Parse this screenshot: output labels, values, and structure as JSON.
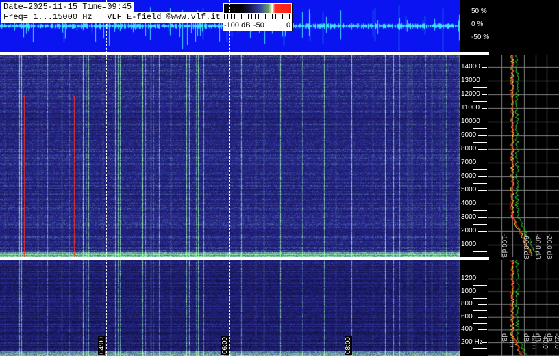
{
  "header": {
    "date_line": "Date=2025-11-15 Time=09:45",
    "freq_line": "Freq= 1...15000 Hz   VLF E-field ©www.vlf.it"
  },
  "colorbar": {
    "labels": [
      "-100 dB",
      "-50",
      "0"
    ],
    "colors": [
      "#000000",
      "#1a1a50",
      "#3a4aa0",
      "#6aa060",
      "#fffff0",
      "#ff2010"
    ]
  },
  "waveform": {
    "labels": [
      "50 %",
      "0 %",
      "-50 %"
    ],
    "background": "#0a14f0",
    "trace_color": "#40e0ff"
  },
  "spectrogram": {
    "freq_labels": [
      "14000",
      "13000",
      "12000",
      "11000",
      "10000",
      "9000",
      "8000",
      "7000",
      "6000",
      "5000",
      "4000",
      "3000",
      "2000",
      "1000"
    ],
    "low_freq_labels": [
      "1200",
      "1000",
      "800",
      "600",
      "400",
      "200 Hz"
    ],
    "time_labels": [
      "04:00",
      "06:00",
      "08:00"
    ]
  },
  "spectrum": {
    "db_labels": [
      "-100 dB",
      "-60.0 dB",
      "-40.0 dB",
      "-20.0 dB"
    ],
    "series_colors": [
      "#30e030",
      "#ffff20",
      "#ff2020"
    ]
  }
}
